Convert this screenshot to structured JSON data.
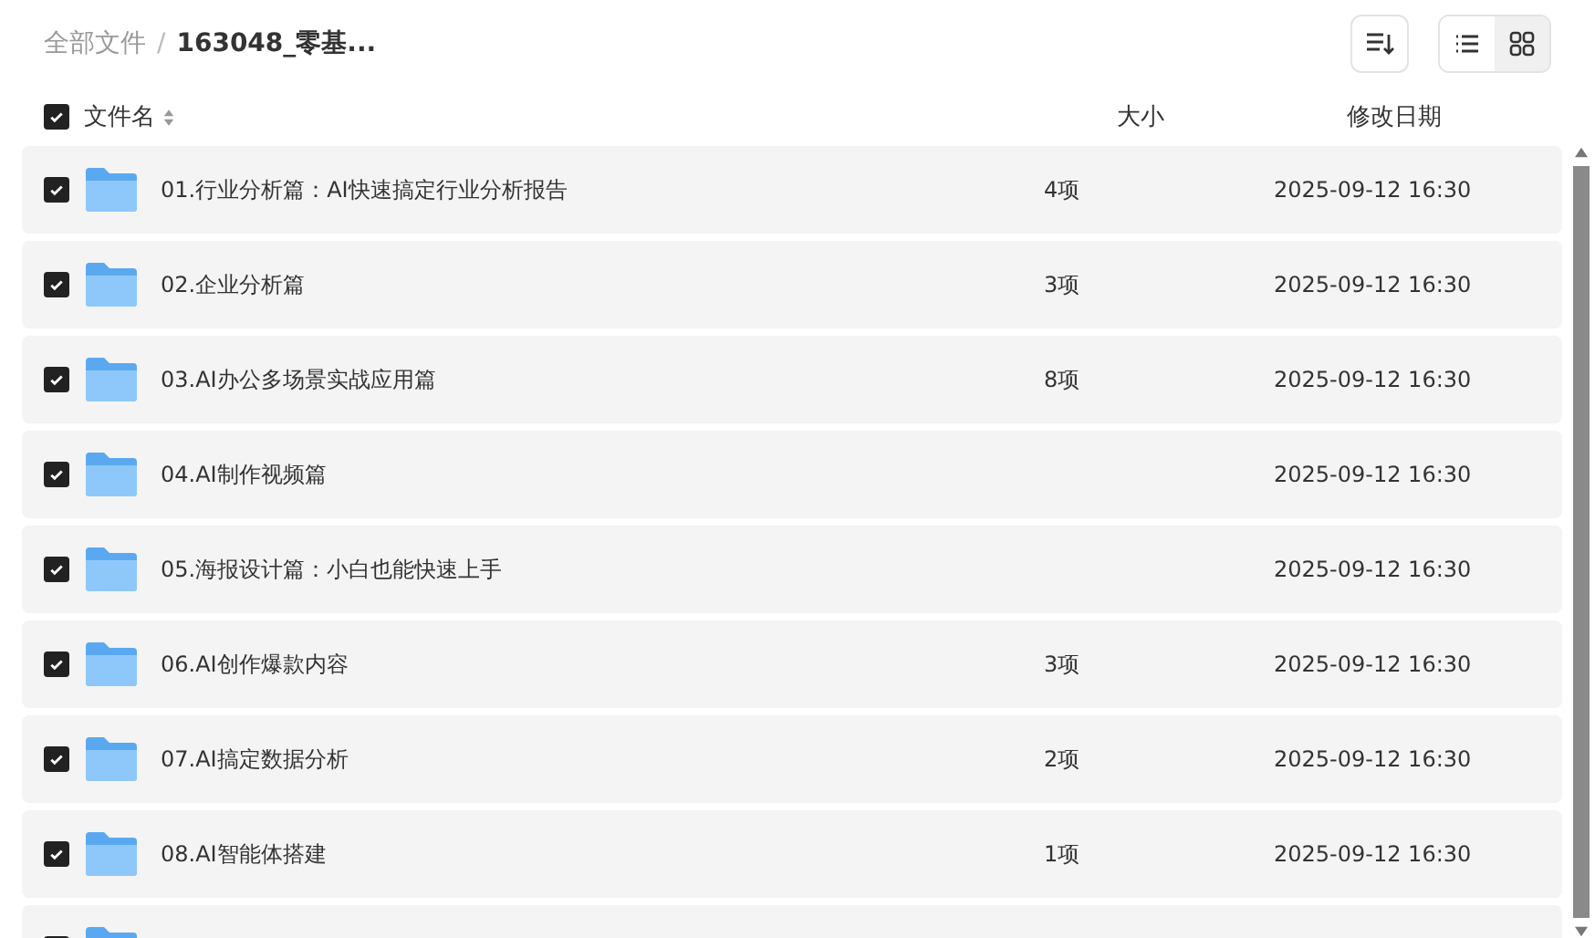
{
  "breadcrumb_separator": "/",
  "breadcrumb": [
    {
      "label": "全部文件",
      "current": false
    },
    {
      "label": "163048_零基...",
      "current": true
    }
  ],
  "toolbar": {
    "sort_button": true,
    "view_toggle": [
      {
        "kind": "list",
        "selected": false
      },
      {
        "kind": "grid",
        "selected": true
      }
    ]
  },
  "header": {
    "checked": true,
    "columns": [
      "文件名",
      "大小",
      "修改日期"
    ]
  },
  "rows": [
    {
      "checked": true,
      "name": "01.行业分析篇：AI快速搞定行业分析报告",
      "size": "4项",
      "date": "2025-09-12 16:30"
    },
    {
      "checked": true,
      "name": "02.企业分析篇",
      "size": "3项",
      "date": "2025-09-12 16:30"
    },
    {
      "checked": true,
      "name": "03.AI办公多场景实战应用篇",
      "size": "8项",
      "date": "2025-09-12 16:30"
    },
    {
      "checked": true,
      "name": "04.AI制作视频篇",
      "date": "2025-09-12 16:30"
    },
    {
      "checked": true,
      "name": "05.海报设计篇：小白也能快速上手",
      "date": "2025-09-12 16:30"
    },
    {
      "checked": true,
      "name": "06.AI创作爆款内容",
      "size": "3项",
      "date": "2025-09-12 16:30"
    },
    {
      "checked": true,
      "name": "07.AI搞定数据分析",
      "size": "2项",
      "date": "2025-09-12 16:30"
    },
    {
      "checked": true,
      "name": "08.AI智能体搭建",
      "size": "1项",
      "date": "2025-09-12 16:30"
    },
    {
      "checked": true
    }
  ]
}
